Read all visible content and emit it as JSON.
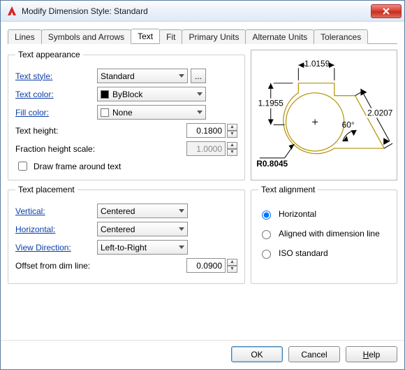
{
  "window": {
    "title": "Modify Dimension Style: Standard"
  },
  "tabs": {
    "items": [
      "Lines",
      "Symbols and Arrows",
      "Text",
      "Fit",
      "Primary Units",
      "Alternate Units",
      "Tolerances"
    ],
    "active": "Text"
  },
  "appearance": {
    "legend": "Text appearance",
    "text_style_label": "Text style:",
    "text_style_value": "Standard",
    "browse_label": "...",
    "text_color_label": "Text color:",
    "text_color_value": "ByBlock",
    "fill_color_label": "Fill color:",
    "fill_color_value": "None",
    "text_height_label": "Text height:",
    "text_height_value": "0.1800",
    "fraction_scale_label": "Fraction height scale:",
    "fraction_scale_value": "1.0000",
    "draw_frame_label": "Draw frame around text"
  },
  "placement": {
    "legend": "Text placement",
    "vertical_label": "Vertical:",
    "vertical_value": "Centered",
    "horizontal_label": "Horizontal:",
    "horizontal_value": "Centered",
    "view_dir_label": "View Direction:",
    "view_dir_value": "Left-to-Right",
    "offset_label": "Offset from dim line:",
    "offset_value": "0.0900"
  },
  "alignment": {
    "legend": "Text alignment",
    "horizontal": "Horizontal",
    "aligned": "Aligned with dimension line",
    "iso": "ISO standard",
    "selected": "horizontal"
  },
  "preview": {
    "dim_top": "1.0159",
    "dim_left": "1.1955",
    "dim_diag": "2.0207",
    "angle": "60°",
    "radius": "R0.8045"
  },
  "footer": {
    "ok": "OK",
    "cancel": "Cancel",
    "help": "Help"
  }
}
